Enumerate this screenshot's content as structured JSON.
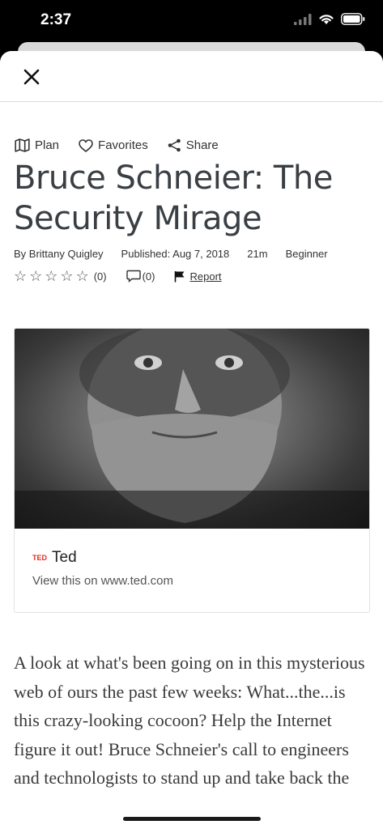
{
  "status_bar": {
    "time": "2:37",
    "icons": [
      "signal-icon",
      "wifi-icon",
      "battery-icon"
    ]
  },
  "actions": {
    "plan_label": "Plan",
    "favorites_label": "Favorites",
    "share_label": "Share"
  },
  "article": {
    "title": "Bruce Schneier: The Security Mirage",
    "author": "By Brittany Quigley",
    "published": "Published: Aug 7, 2018",
    "duration": "21m",
    "level": "Beginner",
    "rating_count": "(0)",
    "comment_count": "(0)",
    "report_label": "Report",
    "star_rating": {
      "value": 0,
      "max": 5
    }
  },
  "card": {
    "logo_text": "TED",
    "source_name": "Ted",
    "link_text": "View this on www.ted.com"
  },
  "description": "A look at what's been going on in this mysterious web of ours the past few weeks: What...the...is this crazy-looking cocoon? Help the Internet figure it out! Bruce Schneier's call to engineers and technologists to stand up and take back the",
  "colors": {
    "accent_red": "#e62b1e",
    "title": "#3a3f44"
  }
}
